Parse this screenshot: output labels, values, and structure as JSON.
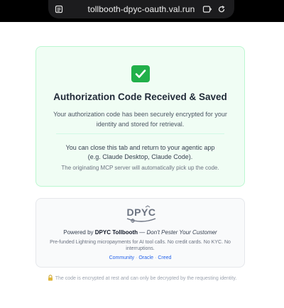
{
  "browser": {
    "url": "tollbooth-dpyc-oauth.val.run",
    "icons": [
      "reader-icon",
      "tabs-icon",
      "reload-icon"
    ]
  },
  "success_card": {
    "icon": "check-mark-icon",
    "title": "Authorization Code Received & Saved",
    "description": "Your authorization code has been securely encrypted for your identity and stored for retrieval.",
    "close_line1": "You can close this tab and return to your agentic app",
    "close_line2": "(e.g. Claude Desktop, Claude Code).",
    "auto_pickup": "The originating MCP server will automatically pick up the code.",
    "colors": {
      "background": "#f0fdf4",
      "border": "#bbf7d0",
      "check": "#21b04a"
    }
  },
  "brand_card": {
    "logo_text": "DPYC",
    "powered_prefix": "Powered by",
    "brand_name": "DPYC Tollbooth",
    "dash": "—",
    "motto": "Don't Pester Your Customer",
    "tagline": "Pre-funded Lightning micropayments for AI tool calls. No credit cards. No KYC. No interruptions.",
    "links": [
      {
        "label": "Community"
      },
      {
        "label": "Oracle"
      },
      {
        "label": "Creed"
      }
    ],
    "link_color": "#2563eb"
  },
  "footer": {
    "icon": "lock-icon",
    "note": "The code is encrypted at rest and can only be decrypted by the requesting identity."
  }
}
